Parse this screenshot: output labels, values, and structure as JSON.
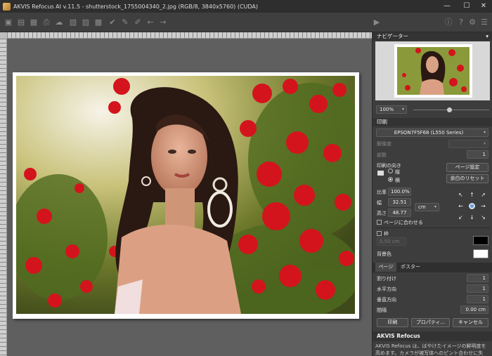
{
  "titlebar": {
    "title": "AKVIS Refocus AI v.11.5 - shutterstock_1755004340_2.jpg (RGB/8, 3840x5760) (CUDA)",
    "min": "—",
    "max": "☐",
    "close": "✕"
  },
  "navigator": {
    "header": "ナビゲーター",
    "zoom": "100%"
  },
  "print": {
    "header": "印刷",
    "printer": "EPSON7F5F68 (L550 Series)",
    "resolution_label": "解像度",
    "copies_label": "部数",
    "copies": "1",
    "orientation_label": "印刷の向き",
    "portrait": "縦",
    "landscape": "横",
    "page_setup": "ページ設定",
    "reset_margins": "余白のリセット",
    "scale_label": "比率",
    "scale": "100.0%",
    "width_label": "幅",
    "width": "32.51",
    "height_label": "高さ",
    "height": "48.77",
    "unit": "cm",
    "fit_page": "ページに合わせる",
    "frame_label": "枠",
    "frame_value": "0.50 cm",
    "frame_color": "#000000",
    "bg_label": "背景色",
    "bg_color": "#ffffff"
  },
  "tabs": {
    "page": "ページ",
    "poster": "ポスター"
  },
  "page_tab": {
    "split_label": "割り付け",
    "split": "1",
    "horizontal_label": "水平方向",
    "horizontal": "1",
    "vertical_label": "垂直方向",
    "vertical": "1",
    "gap_label": "間隔",
    "gap": "0.00 cm"
  },
  "buttons": {
    "print": "印刷",
    "properties": "プロパティ...",
    "cancel": "キャンセル"
  },
  "help": {
    "title": "AKVIS Refocus",
    "text": "AKVIS Refocus は、ぼやけたイメージの鮮明度を高めます。カメラが被写体へのピント合わせに失敗したときや"
  },
  "colors": {
    "accent": "#6aa0d8"
  }
}
